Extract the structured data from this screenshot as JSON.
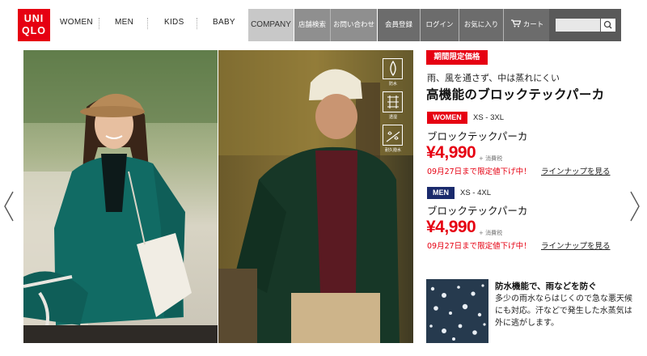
{
  "header": {
    "logo": [
      "UNI",
      "QLO"
    ],
    "nav": [
      "WOMEN",
      "MEN",
      "KIDS",
      "BABY"
    ],
    "company": "COMPANY",
    "utilities": [
      "店舗検索",
      "お問い合わせ",
      "会員登録",
      "ログイン",
      "お気に入り",
      "カート"
    ],
    "search_placeholder": ""
  },
  "feature_icons": [
    "防水",
    "透湿",
    "耐久撥水"
  ],
  "promo": {
    "tag": "期間限定価格",
    "sub_copy": "雨、風を通さず、中は蒸れにくい",
    "title": "高機能のブロックテックパーカ"
  },
  "products": [
    {
      "gender": "WOMEN",
      "size": "XS - 3XL",
      "name": "ブロックテックパーカ",
      "price": "¥4,990",
      "tax": "+ 消費税",
      "deadline": "09月27日まで限定値下げ中！",
      "lineup": "ラインナップを見る",
      "color": "#e60012"
    },
    {
      "gender": "MEN",
      "size": "XS - 4XL",
      "name": "ブロックテックパーカ",
      "price": "¥4,990",
      "tax": "+ 消費税",
      "deadline": "09月27日まで限定値下げ中！",
      "lineup": "ラインナップを見る",
      "color": "#1a2a6c"
    }
  ],
  "feature": {
    "title": "防水機能で、雨などを防ぐ",
    "body": "多少の雨水ならはじくので急な悪天候にも対応。汗などで発生した水蒸気は外に逃がします。"
  },
  "colors": {
    "brand": "#e60012",
    "men": "#1a2a6c"
  }
}
